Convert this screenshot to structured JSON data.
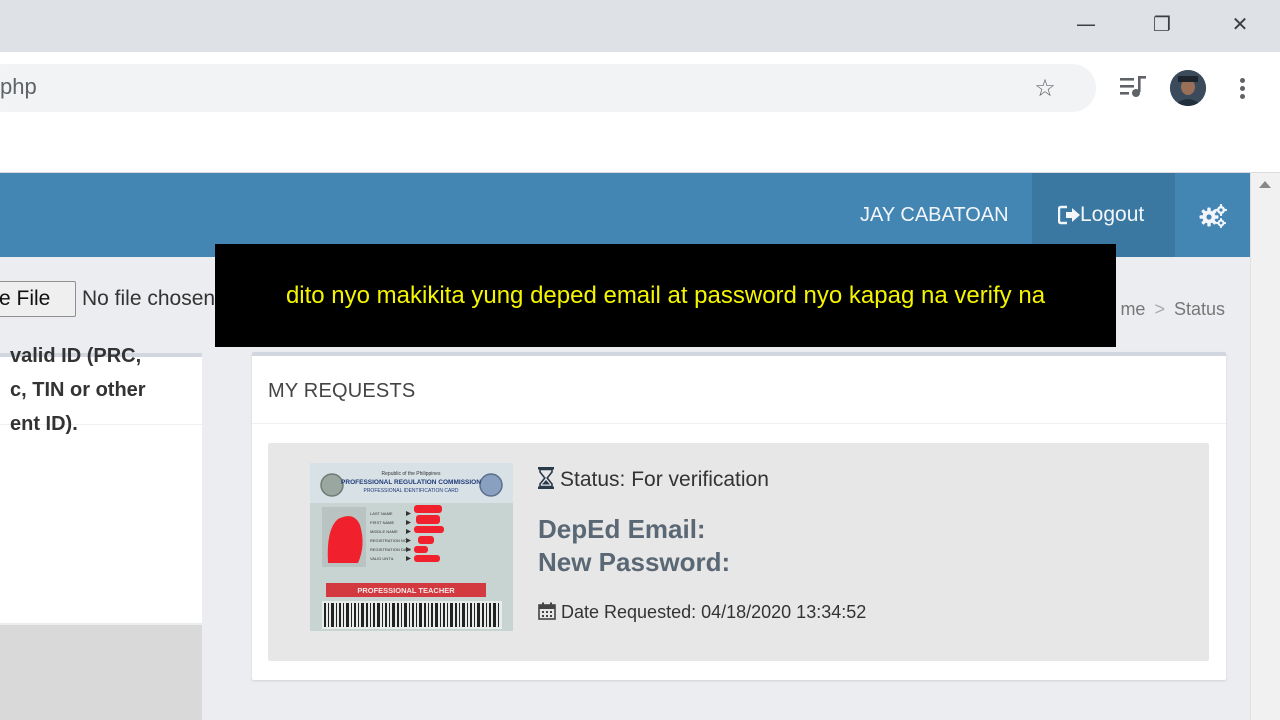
{
  "browser": {
    "window_controls": {
      "minimize": "—",
      "restore": "❐",
      "close": "✕"
    },
    "address_text": "php",
    "icons": [
      "star-icon",
      "media-queue-icon",
      "avatar",
      "kebab-menu-icon"
    ]
  },
  "navbar": {
    "user_name": "JAY CABATOAN",
    "logout_label": "Logout",
    "color": "#4386b4"
  },
  "breadcrumb": {
    "items": [
      "me",
      "Status"
    ],
    "separator": ">"
  },
  "upload": {
    "button_label": "e File",
    "status_text": "No file chosen",
    "hint": "valid ID (PRC,\nc, TIN or other\nent ID)."
  },
  "requests": {
    "title": "MY REQUESTS",
    "status": "Status: For verification",
    "email_label": "DepEd Email:",
    "password_label": "New Password:",
    "date_requested": "Date Requested: 04/18/2020 13:34:52",
    "id_card": {
      "country": "Republic of the Philippines",
      "agency": "PROFESSIONAL REGULATION COMMISSION",
      "card_type": "PROFESSIONAL IDENTIFICATION CARD",
      "fields": [
        "LAST NAME",
        "FIRST NAME",
        "MIDDLE NAME",
        "REGISTRATION NO.",
        "REGISTRATION DATE",
        "VALID UNTIL"
      ],
      "profession": "PROFESSIONAL TEACHER"
    }
  },
  "subtitle": {
    "text": "dito nyo makikita yung deped email at password nyo kapag na verify na",
    "color": "#f5f500"
  }
}
